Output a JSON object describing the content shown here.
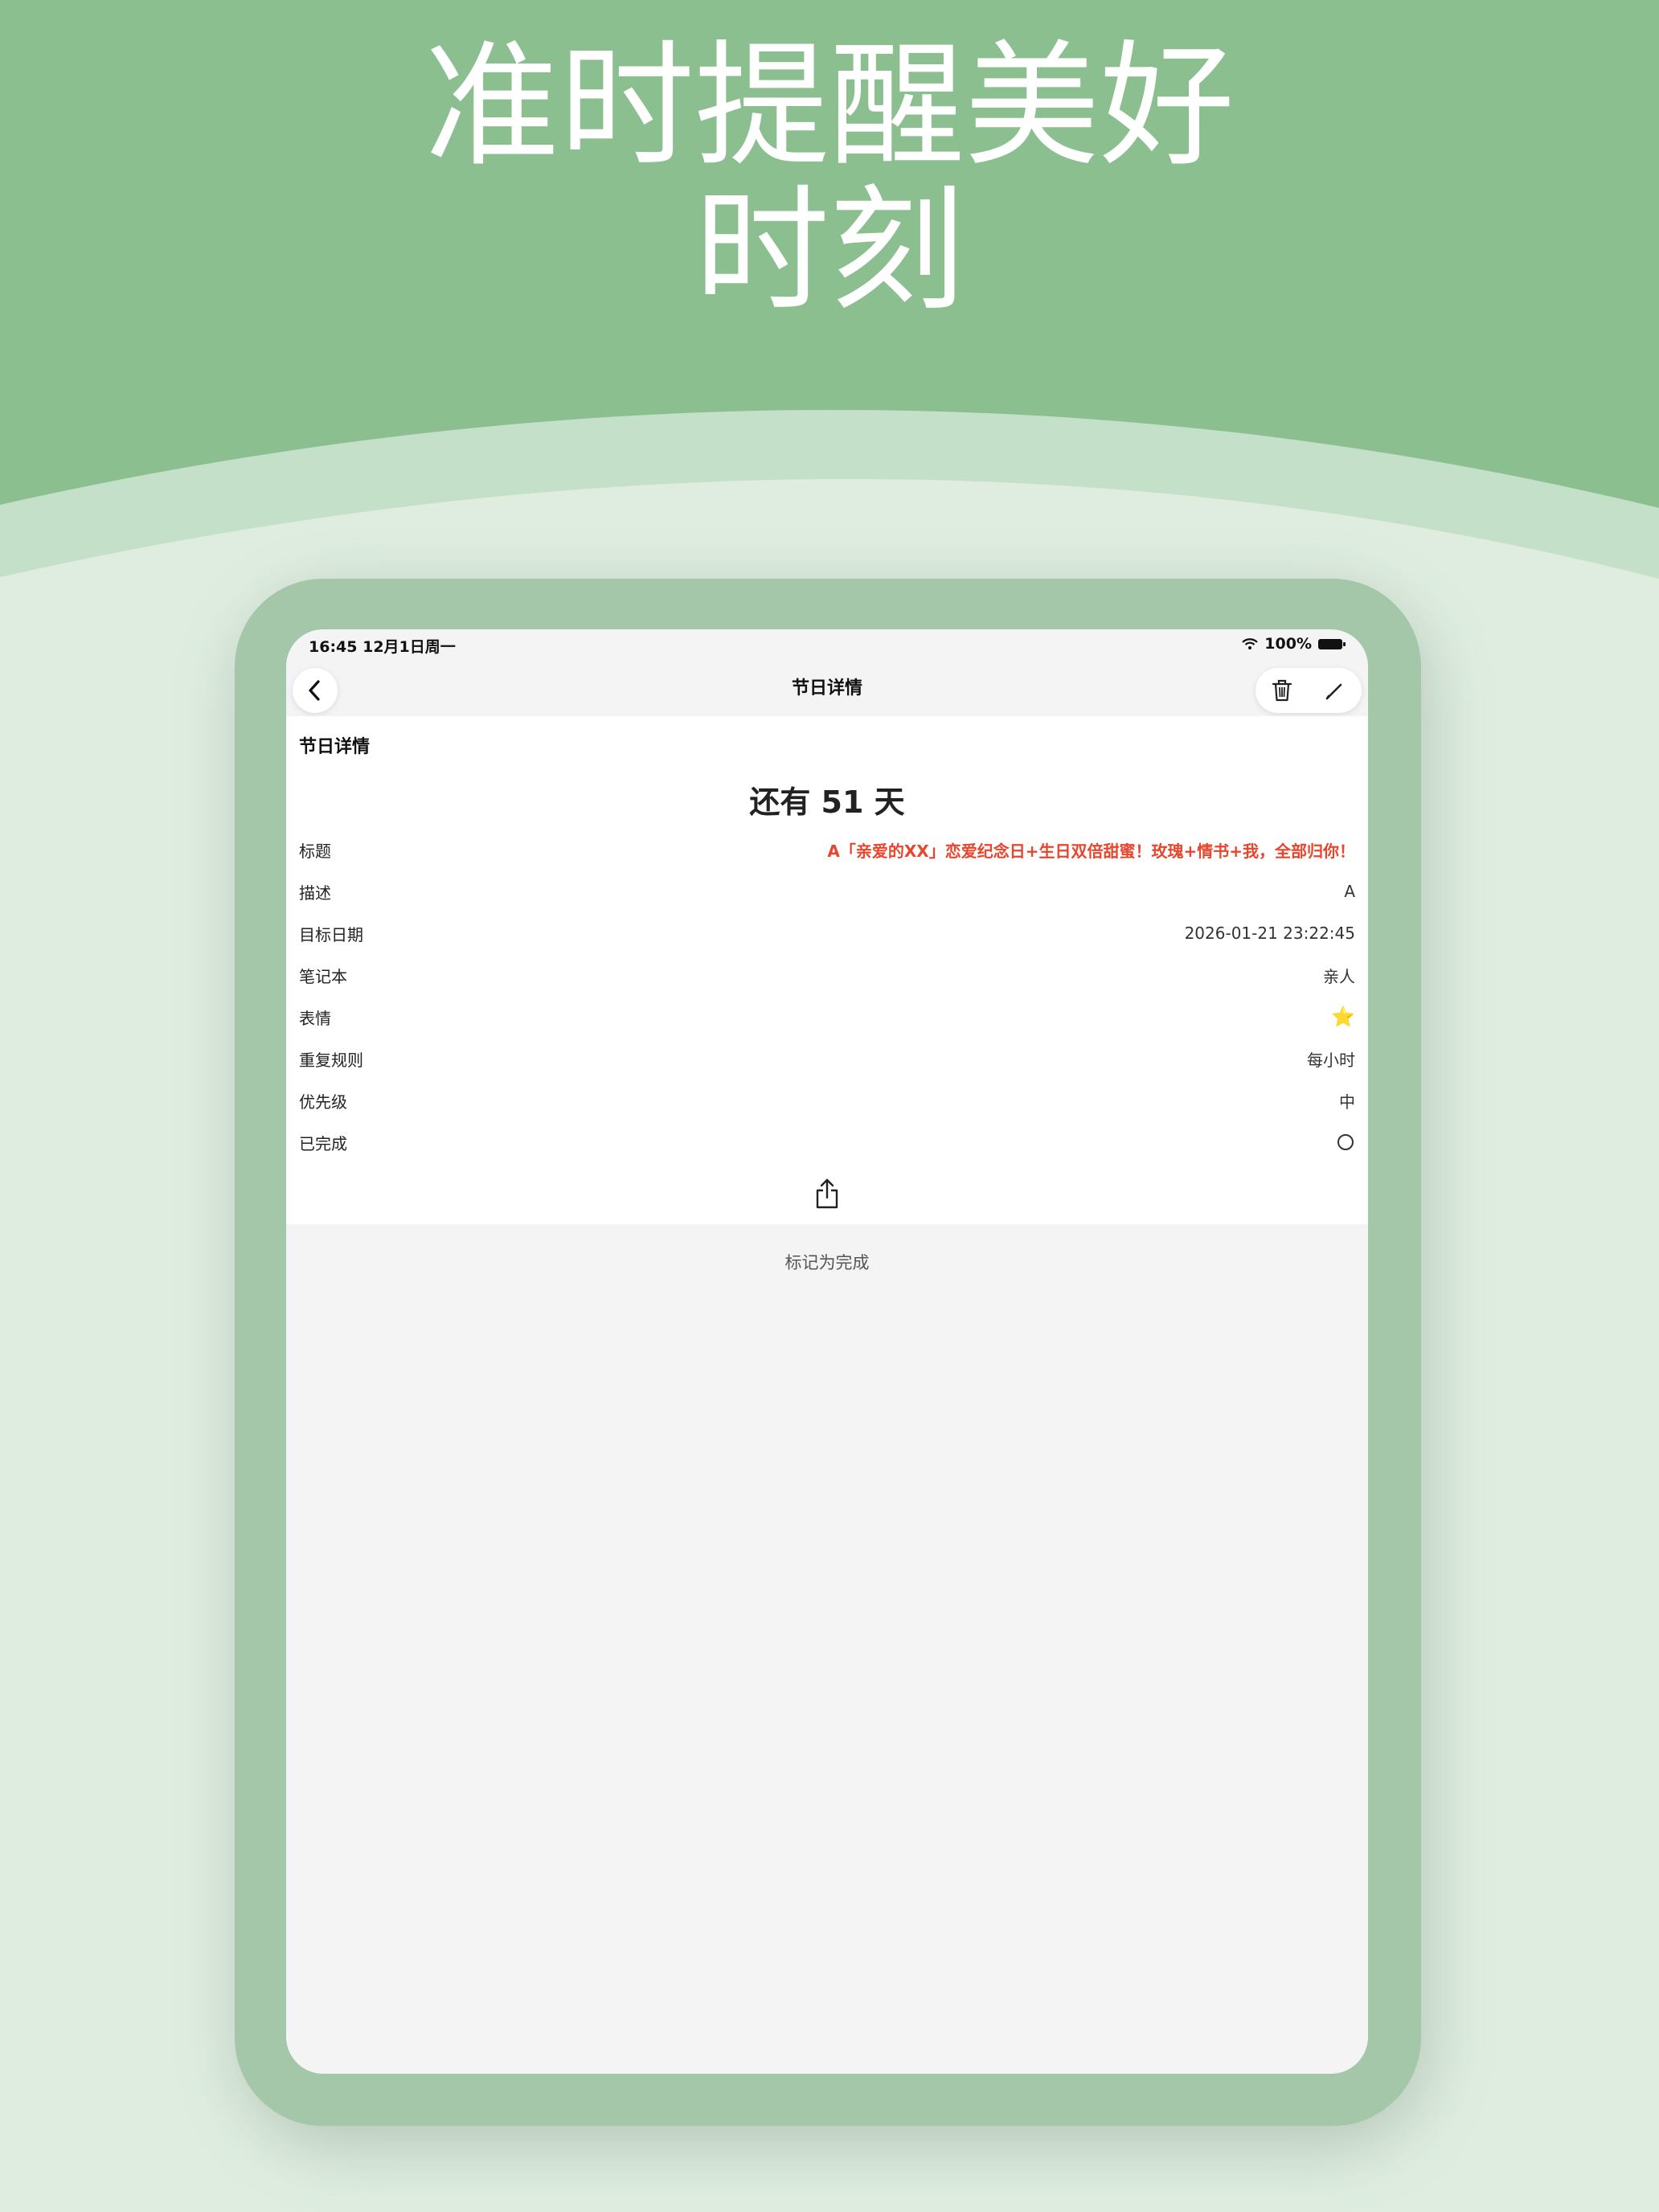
{
  "headline": {
    "line1": "准时提醒美好",
    "line2": "时刻"
  },
  "status_bar": {
    "time_date": "16:45  12月1日周一",
    "battery": "100%"
  },
  "nav": {
    "title": "节日详情"
  },
  "detail": {
    "section_title": "节日详情",
    "countdown": "还有 51 天",
    "rows": [
      {
        "label": "标题",
        "value": "A「亲爱的XX」恋爱纪念日+生日双倍甜蜜！玫瑰+情书+我，全部归你！"
      },
      {
        "label": "描述",
        "value": "A"
      },
      {
        "label": "目标日期",
        "value": "2026-01-21 23:22:45"
      },
      {
        "label": "笔记本",
        "value": "亲人"
      },
      {
        "label": "表情",
        "value": "⭐"
      },
      {
        "label": "重复规则",
        "value": "每小时"
      },
      {
        "label": "优先级",
        "value": "中"
      },
      {
        "label": "已完成",
        "value": ""
      }
    ]
  },
  "footer": {
    "mark_done": "标记为完成"
  },
  "colors": {
    "banner": "#8cbf8f",
    "device_frame": "#a3c7a8",
    "background": "#deede0",
    "title_red": "#e8452c"
  },
  "icons": [
    "chevron-left-icon",
    "trash-icon",
    "pencil-icon",
    "share-icon",
    "wifi-icon",
    "battery-icon",
    "circle-icon"
  ]
}
